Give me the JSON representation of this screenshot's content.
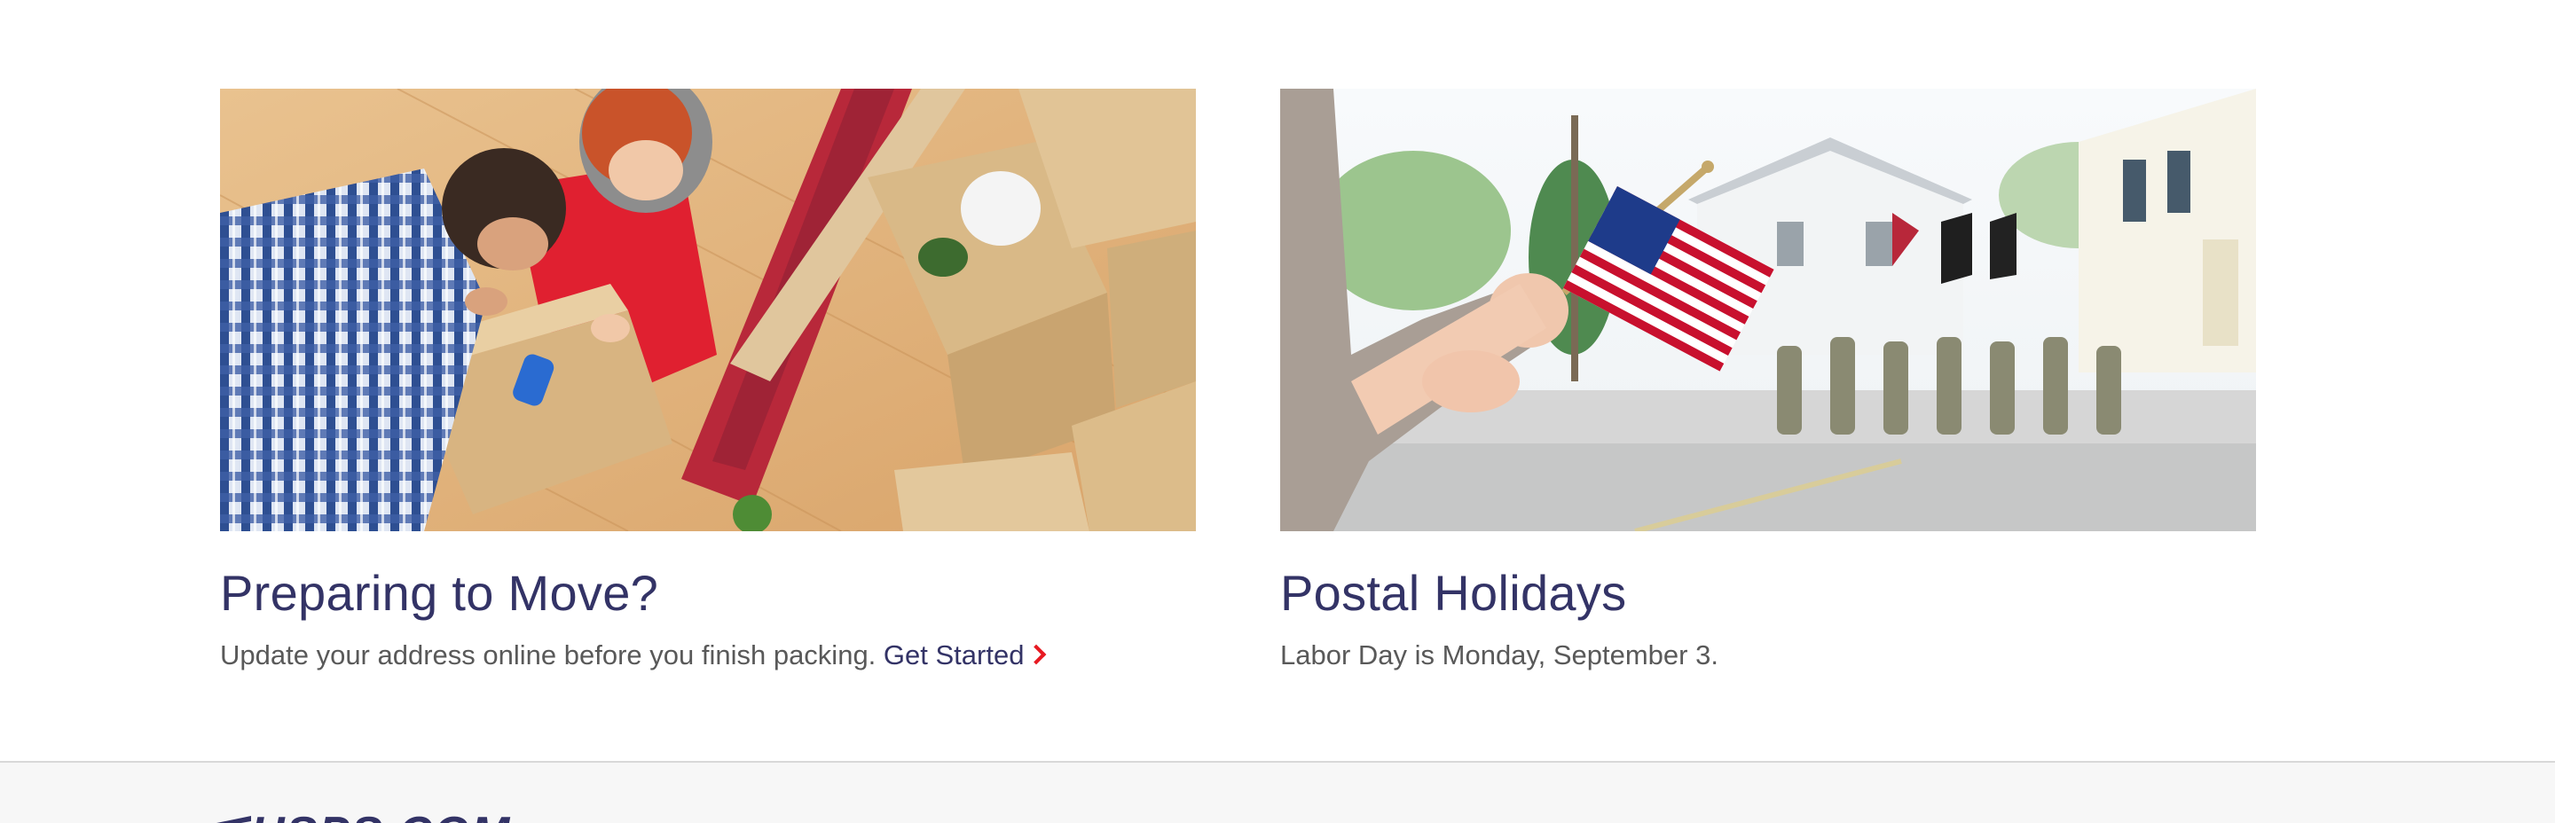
{
  "cards": [
    {
      "image_alt": "Couple packing moving boxes on a wooden floor",
      "title": "Preparing to Move?",
      "description": "Update your address online before you finish packing.",
      "link_label": "Get Started"
    },
    {
      "image_alt": "Parade with a child holding an American flag",
      "title": "Postal Holidays",
      "description": "Labor Day is Monday, September 3."
    }
  ],
  "footer": {
    "logo_text": "USPS.COM"
  },
  "colors": {
    "heading": "#333366",
    "body_text": "#595959",
    "accent_red": "#e71921",
    "footer_bg": "#f7f7f7"
  }
}
